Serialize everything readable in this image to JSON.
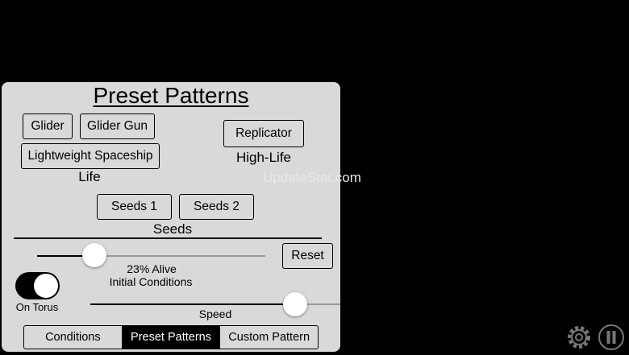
{
  "panel": {
    "title": "Preset Patterns",
    "life": {
      "buttons": [
        "Glider",
        "Glider Gun",
        "Lightweight Spaceship"
      ],
      "label": "Life"
    },
    "highlife": {
      "button": "Replicator",
      "label": "High-Life"
    },
    "seeds": {
      "buttons": [
        "Seeds 1",
        "Seeds 2"
      ],
      "label": "Seeds"
    },
    "initial_conditions": {
      "alive_text": "23% Alive",
      "label": "Initial Conditions",
      "alive_fraction": 0.23,
      "reset_label": "Reset"
    },
    "torus": {
      "label": "On Torus",
      "on": true
    },
    "speed": {
      "label": "Speed"
    },
    "tabs": [
      "Conditions",
      "Preset Patterns",
      "Custom Pattern"
    ],
    "active_tab": "Preset Patterns"
  },
  "watermark": "UpdateStar.com",
  "controls": {
    "settings_icon": "gear-icon",
    "pause_icon": "pause-icon"
  },
  "colors": {
    "background": "#000000",
    "panel": "#d9d9d9",
    "active_tab": "#000000"
  }
}
